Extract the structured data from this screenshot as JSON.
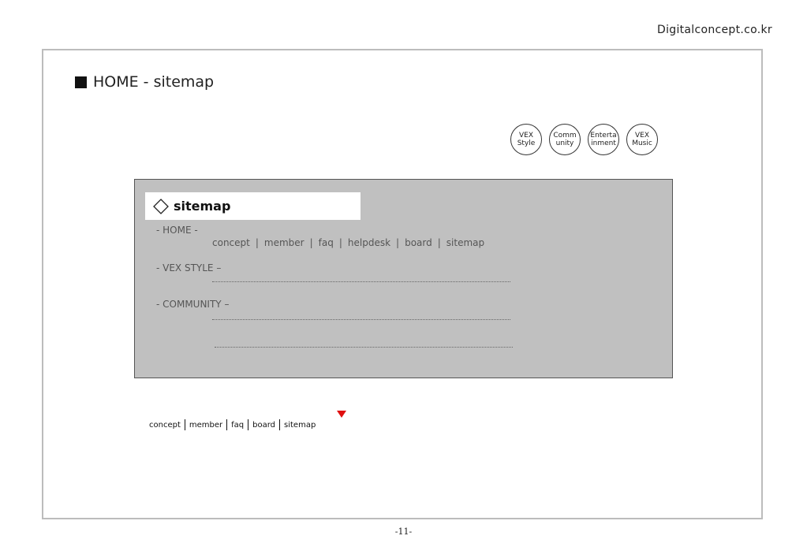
{
  "site_name": "Digitalconcept.co.kr",
  "page_title": "HOME - sitemap",
  "circle_nav": [
    {
      "label": "VEX\nStyle"
    },
    {
      "label": "Comm\nunity"
    },
    {
      "label": "Enterta\ninment"
    },
    {
      "label": "VEX\nMusic"
    }
  ],
  "panel": {
    "title": "sitemap",
    "sections": [
      {
        "label": "- HOME -"
      },
      {
        "label": "- VEX STYLE –"
      },
      {
        "label": "- COMMUNITY –"
      }
    ],
    "home_links": [
      "concept",
      "member",
      "faq",
      "helpdesk",
      "board",
      "sitemap"
    ],
    "separator": "|"
  },
  "footer_nav": [
    "concept",
    "member",
    "faq",
    "board",
    "sitemap"
  ],
  "page_number": "-11-",
  "colors": {
    "panel_bg": "#c0c0c0",
    "marker": "#e01010"
  }
}
